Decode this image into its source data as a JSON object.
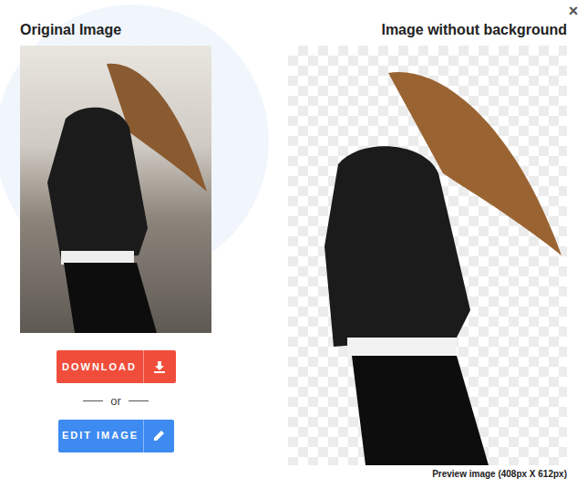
{
  "dialog": {
    "close": "×"
  },
  "original": {
    "title": "Original Image"
  },
  "result": {
    "title": "Image without background",
    "caption": "Preview image (408px X 612px)"
  },
  "buttons": {
    "download": "DOWNLOAD",
    "separator": "or",
    "edit": "EDIT IMAGE"
  }
}
